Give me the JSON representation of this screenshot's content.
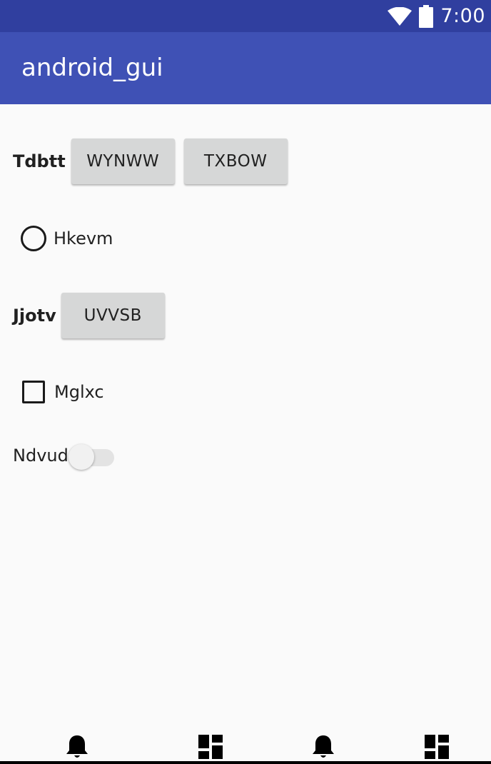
{
  "status_bar": {
    "time": "7:00",
    "icons": [
      "wifi-icon",
      "battery-icon"
    ]
  },
  "app_bar": {
    "title": "android_gui"
  },
  "rows": {
    "row1": {
      "label": "Tdbtt",
      "buttons": [
        "WYNWW",
        "TXBOW"
      ]
    },
    "radio": {
      "label": "Hkevm",
      "checked": false
    },
    "row3": {
      "label": "Jjotv",
      "button": "UVVSB"
    },
    "checkbox": {
      "label": "Mglxc",
      "checked": false
    },
    "switch": {
      "label": "Ndvud",
      "on": false
    }
  },
  "bottom_nav": {
    "items": [
      "bell-icon",
      "dashboard-icon",
      "bell-icon",
      "dashboard-icon"
    ]
  },
  "colors": {
    "status_bar": "#303f9f",
    "app_bar": "#3f51b5",
    "background": "#fafafa",
    "button": "#d6d7d7"
  }
}
